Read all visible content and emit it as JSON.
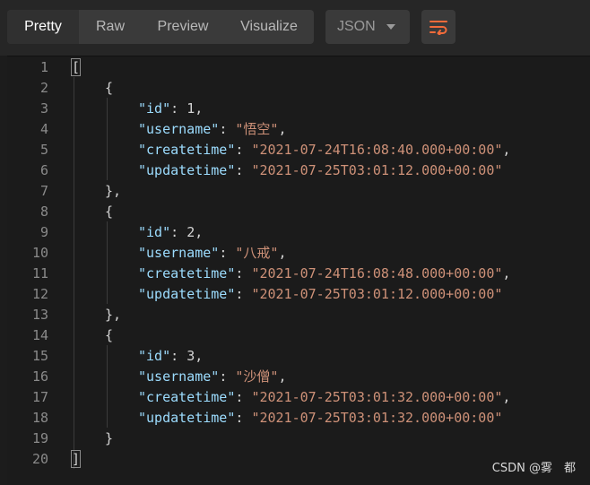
{
  "toolbar": {
    "tabs": [
      {
        "label": "Pretty",
        "active": true
      },
      {
        "label": "Raw",
        "active": false
      },
      {
        "label": "Preview",
        "active": false
      },
      {
        "label": "Visualize",
        "active": false
      }
    ],
    "format_select": "JSON",
    "wrap_icon": "wrap-lines-icon",
    "accent": "#f26b3a"
  },
  "editor": {
    "lines": [
      {
        "n": "1",
        "indent": 0,
        "parts": [
          [
            "punc",
            "["
          ]
        ]
      },
      {
        "n": "2",
        "indent": 1,
        "parts": [
          [
            "punc",
            "{"
          ]
        ]
      },
      {
        "n": "3",
        "indent": 2,
        "parts": [
          [
            "key",
            "\"id\""
          ],
          [
            "punc",
            ": "
          ],
          [
            "num",
            "1"
          ],
          [
            "punc",
            ","
          ]
        ]
      },
      {
        "n": "4",
        "indent": 2,
        "parts": [
          [
            "key",
            "\"username\""
          ],
          [
            "punc",
            ": "
          ],
          [
            "str",
            "\"悟空\""
          ],
          [
            "punc",
            ","
          ]
        ]
      },
      {
        "n": "5",
        "indent": 2,
        "parts": [
          [
            "key",
            "\"createtime\""
          ],
          [
            "punc",
            ": "
          ],
          [
            "str",
            "\"2021-07-24T16:08:40.000+00:00\""
          ],
          [
            "punc",
            ","
          ]
        ]
      },
      {
        "n": "6",
        "indent": 2,
        "parts": [
          [
            "key",
            "\"updatetime\""
          ],
          [
            "punc",
            ": "
          ],
          [
            "str",
            "\"2021-07-25T03:01:12.000+00:00\""
          ]
        ]
      },
      {
        "n": "7",
        "indent": 1,
        "parts": [
          [
            "punc",
            "},"
          ]
        ]
      },
      {
        "n": "8",
        "indent": 1,
        "parts": [
          [
            "punc",
            "{"
          ]
        ]
      },
      {
        "n": "9",
        "indent": 2,
        "parts": [
          [
            "key",
            "\"id\""
          ],
          [
            "punc",
            ": "
          ],
          [
            "num",
            "2"
          ],
          [
            "punc",
            ","
          ]
        ]
      },
      {
        "n": "10",
        "indent": 2,
        "parts": [
          [
            "key",
            "\"username\""
          ],
          [
            "punc",
            ": "
          ],
          [
            "str",
            "\"八戒\""
          ],
          [
            "punc",
            ","
          ]
        ]
      },
      {
        "n": "11",
        "indent": 2,
        "parts": [
          [
            "key",
            "\"createtime\""
          ],
          [
            "punc",
            ": "
          ],
          [
            "str",
            "\"2021-07-24T16:08:48.000+00:00\""
          ],
          [
            "punc",
            ","
          ]
        ]
      },
      {
        "n": "12",
        "indent": 2,
        "parts": [
          [
            "key",
            "\"updatetime\""
          ],
          [
            "punc",
            ": "
          ],
          [
            "str",
            "\"2021-07-25T03:01:12.000+00:00\""
          ]
        ]
      },
      {
        "n": "13",
        "indent": 1,
        "parts": [
          [
            "punc",
            "},"
          ]
        ]
      },
      {
        "n": "14",
        "indent": 1,
        "parts": [
          [
            "punc",
            "{"
          ]
        ]
      },
      {
        "n": "15",
        "indent": 2,
        "parts": [
          [
            "key",
            "\"id\""
          ],
          [
            "punc",
            ": "
          ],
          [
            "num",
            "3"
          ],
          [
            "punc",
            ","
          ]
        ]
      },
      {
        "n": "16",
        "indent": 2,
        "parts": [
          [
            "key",
            "\"username\""
          ],
          [
            "punc",
            ": "
          ],
          [
            "str",
            "\"沙僧\""
          ],
          [
            "punc",
            ","
          ]
        ]
      },
      {
        "n": "17",
        "indent": 2,
        "parts": [
          [
            "key",
            "\"createtime\""
          ],
          [
            "punc",
            ": "
          ],
          [
            "str",
            "\"2021-07-25T03:01:32.000+00:00\""
          ],
          [
            "punc",
            ","
          ]
        ]
      },
      {
        "n": "18",
        "indent": 2,
        "parts": [
          [
            "key",
            "\"updatetime\""
          ],
          [
            "punc",
            ": "
          ],
          [
            "str",
            "\"2021-07-25T03:01:32.000+00:00\""
          ]
        ]
      },
      {
        "n": "19",
        "indent": 1,
        "parts": [
          [
            "punc",
            "}"
          ]
        ]
      },
      {
        "n": "20",
        "indent": 0,
        "parts": [
          [
            "punc",
            "]"
          ]
        ]
      }
    ]
  },
  "watermark": "CSDN @雾　都"
}
